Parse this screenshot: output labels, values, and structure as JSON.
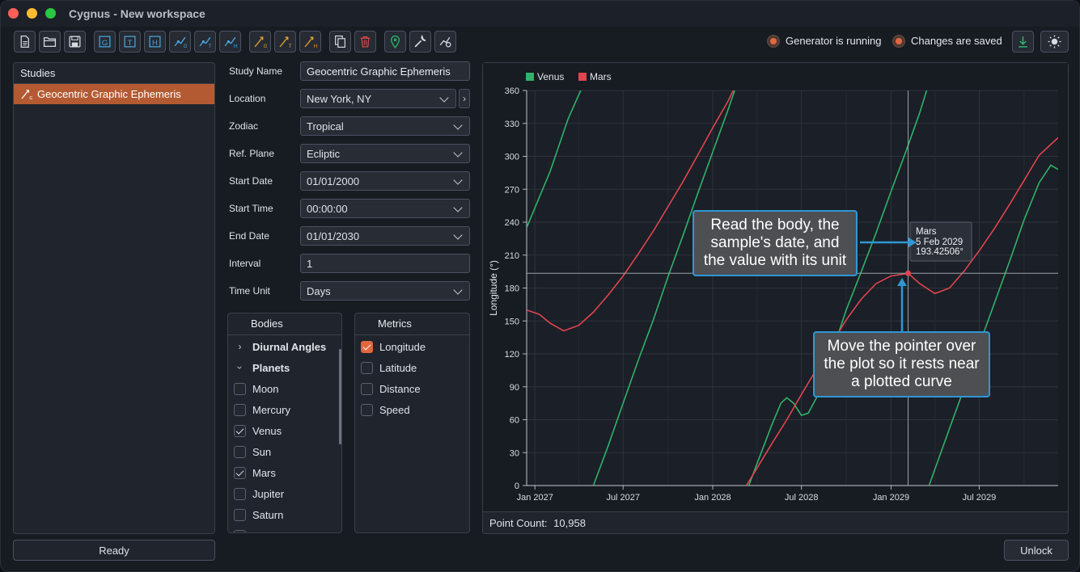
{
  "window": {
    "title": "Cygnus - New workspace"
  },
  "toolbar": {
    "buttons": [
      "new-file-icon",
      "open-folder-icon",
      "save-icon",
      "g-icon",
      "t-icon",
      "h-icon",
      "graph-g-icon",
      "graph-t-icon",
      "graph-h-icon",
      "ephem-g-icon",
      "ephem-t-icon",
      "ephem-h-icon",
      "copy-icon",
      "trash-icon",
      "location-pin-icon",
      "wrench-icon",
      "settings-graph-icon"
    ],
    "status1": "Generator is running",
    "status2": "Changes are saved",
    "accent": "#e2673e"
  },
  "studies": {
    "header": "Studies",
    "items": [
      "Geocentric Graphic Ephemeris"
    ]
  },
  "footer": {
    "ready": "Ready",
    "unlock": "Unlock"
  },
  "form": {
    "study_name_label": "Study Name",
    "study_name": "Geocentric Graphic Ephemeris",
    "location_label": "Location",
    "location": "New York, NY",
    "zodiac_label": "Zodiac",
    "zodiac": "Tropical",
    "ref_plane_label": "Ref. Plane",
    "ref_plane": "Ecliptic",
    "start_date_label": "Start Date",
    "start_date": "01/01/2000",
    "start_time_label": "Start Time",
    "start_time": "00:00:00",
    "end_date_label": "End Date",
    "end_date": "01/01/2030",
    "interval_label": "Interval",
    "interval": "1",
    "time_unit_label": "Time Unit",
    "time_unit": "Days"
  },
  "bodies": {
    "header": "Bodies",
    "groups": [
      {
        "label": "Diurnal Angles"
      },
      {
        "label": "Planets"
      }
    ],
    "items": [
      {
        "label": "Moon",
        "checked": false
      },
      {
        "label": "Mercury",
        "checked": false
      },
      {
        "label": "Venus",
        "checked": true
      },
      {
        "label": "Sun",
        "checked": false
      },
      {
        "label": "Mars",
        "checked": true
      },
      {
        "label": "Jupiter",
        "checked": false
      },
      {
        "label": "Saturn",
        "checked": false
      }
    ]
  },
  "metrics": {
    "header": "Metrics",
    "items": [
      {
        "label": "Longitude",
        "checked": true
      },
      {
        "label": "Latitude",
        "checked": false
      },
      {
        "label": "Distance",
        "checked": false
      },
      {
        "label": "Speed",
        "checked": false
      }
    ]
  },
  "chart": {
    "point_count_label": "Point Count:",
    "point_count": "10,958",
    "tooltip": {
      "body": "Mars",
      "date": "5 Feb 2029",
      "value": "193.42506°"
    },
    "callout_top": "Read the body, the sample's date, and the value with its unit",
    "callout_bottom": "Move the pointer over the plot so it rests near a plotted curve"
  },
  "chart_data": {
    "type": "line",
    "ylabel": "Longitude (°)",
    "ylim": [
      0,
      360
    ],
    "yticks": [
      0,
      30,
      60,
      90,
      120,
      150,
      180,
      210,
      240,
      270,
      300,
      330,
      360
    ],
    "xticks": [
      "Jan 2027",
      "Jul 2027",
      "Jan 2028",
      "Jul 2028",
      "Jan 2029",
      "Jul 2029"
    ],
    "legend_position": "top-left",
    "grid": true,
    "series": [
      {
        "name": "Venus",
        "color": "#2fb36a",
        "points": [
          [
            "2026-12-15",
            235
          ],
          [
            "2027-02-01",
            286
          ],
          [
            "2027-03-10",
            334
          ],
          [
            "2027-04-05",
            360
          ],
          [
            "2027-05-01",
            0
          ],
          [
            "2027-06-01",
            37
          ],
          [
            "2027-07-01",
            75
          ],
          [
            "2027-08-01",
            114
          ],
          [
            "2027-09-01",
            151
          ],
          [
            "2027-10-01",
            190
          ],
          [
            "2027-11-01",
            228
          ],
          [
            "2027-12-01",
            266
          ],
          [
            "2028-01-01",
            304
          ],
          [
            "2028-02-01",
            342
          ],
          [
            "2028-02-15",
            360
          ],
          [
            "2028-03-15",
            0
          ],
          [
            "2028-04-01",
            20
          ],
          [
            "2028-05-01",
            55
          ],
          [
            "2028-05-20",
            75
          ],
          [
            "2028-06-01",
            80
          ],
          [
            "2028-06-15",
            75
          ],
          [
            "2028-07-01",
            64
          ],
          [
            "2028-07-15",
            66
          ],
          [
            "2028-08-01",
            80
          ],
          [
            "2028-09-01",
            120
          ],
          [
            "2028-10-01",
            160
          ],
          [
            "2028-11-01",
            195
          ],
          [
            "2028-12-01",
            230
          ],
          [
            "2029-01-01",
            268
          ],
          [
            "2029-02-01",
            305
          ],
          [
            "2029-03-01",
            340
          ],
          [
            "2029-03-15",
            360
          ],
          [
            "2029-03-20",
            0
          ],
          [
            "2029-05-01",
            52
          ],
          [
            "2029-06-01",
            90
          ],
          [
            "2029-07-01",
            128
          ],
          [
            "2029-08-01",
            166
          ],
          [
            "2029-09-01",
            204
          ],
          [
            "2029-10-01",
            242
          ],
          [
            "2029-11-01",
            276
          ],
          [
            "2029-11-25",
            292
          ],
          [
            "2029-12-10",
            288
          ]
        ]
      },
      {
        "name": "Mars",
        "color": "#e0454f",
        "points": [
          [
            "2026-12-15",
            160
          ],
          [
            "2027-01-10",
            156
          ],
          [
            "2027-02-01",
            148
          ],
          [
            "2027-03-01",
            141
          ],
          [
            "2027-04-01",
            146
          ],
          [
            "2027-05-01",
            158
          ],
          [
            "2027-06-01",
            174
          ],
          [
            "2027-07-01",
            191
          ],
          [
            "2027-08-01",
            211
          ],
          [
            "2027-09-01",
            232
          ],
          [
            "2027-10-01",
            254
          ],
          [
            "2027-11-01",
            277
          ],
          [
            "2027-12-01",
            301
          ],
          [
            "2028-01-01",
            326
          ],
          [
            "2028-02-01",
            350
          ],
          [
            "2028-02-12",
            360
          ],
          [
            "2028-03-10",
            0
          ],
          [
            "2028-04-01",
            16
          ],
          [
            "2028-05-01",
            38
          ],
          [
            "2028-06-01",
            60
          ],
          [
            "2028-07-01",
            83
          ],
          [
            "2028-08-01",
            106
          ],
          [
            "2028-09-01",
            129
          ],
          [
            "2028-10-01",
            151
          ],
          [
            "2028-11-01",
            170
          ],
          [
            "2028-12-01",
            184
          ],
          [
            "2029-01-01",
            191
          ],
          [
            "2029-02-05",
            193.42506
          ],
          [
            "2029-03-01",
            184
          ],
          [
            "2029-04-01",
            175
          ],
          [
            "2029-05-01",
            180
          ],
          [
            "2029-06-01",
            196
          ],
          [
            "2029-07-01",
            214
          ],
          [
            "2029-08-01",
            234
          ],
          [
            "2029-09-01",
            256
          ],
          [
            "2029-10-01",
            278
          ],
          [
            "2029-11-01",
            301
          ],
          [
            "2029-12-10",
            317
          ]
        ]
      }
    ]
  }
}
